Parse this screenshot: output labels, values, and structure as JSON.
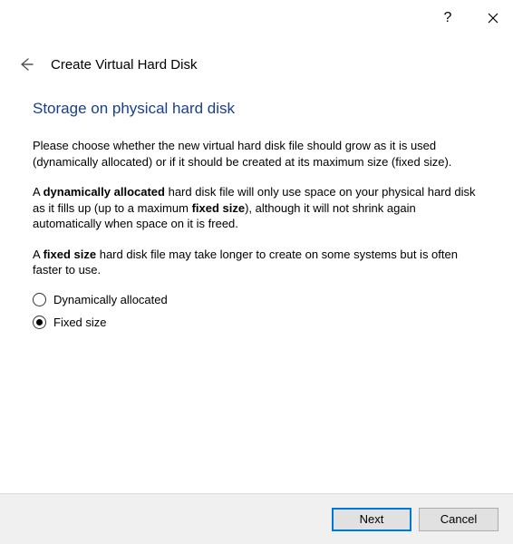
{
  "titlebar": {
    "help_icon": "?",
    "close_icon": "close"
  },
  "header": {
    "back_icon": "back-arrow",
    "title": "Create Virtual Hard Disk"
  },
  "content": {
    "heading": "Storage on physical hard disk",
    "para1": "Please choose whether the new virtual hard disk file should grow as it is used (dynamically allocated) or if it should be created at its maximum size (fixed size).",
    "para2_a": "A ",
    "para2_b": "dynamically allocated",
    "para2_c": " hard disk file will only use space on your physical hard disk as it fills up (up to a maximum ",
    "para2_d": "fixed size",
    "para2_e": "), although it will not shrink again automatically when space on it is freed.",
    "para3_a": "A ",
    "para3_b": "fixed size",
    "para3_c": " hard disk file may take longer to create on some systems but is often faster to use.",
    "options": [
      {
        "label": "Dynamically allocated",
        "selected": false
      },
      {
        "label": "Fixed size",
        "selected": true
      }
    ]
  },
  "footer": {
    "next": "Next",
    "cancel": "Cancel"
  }
}
